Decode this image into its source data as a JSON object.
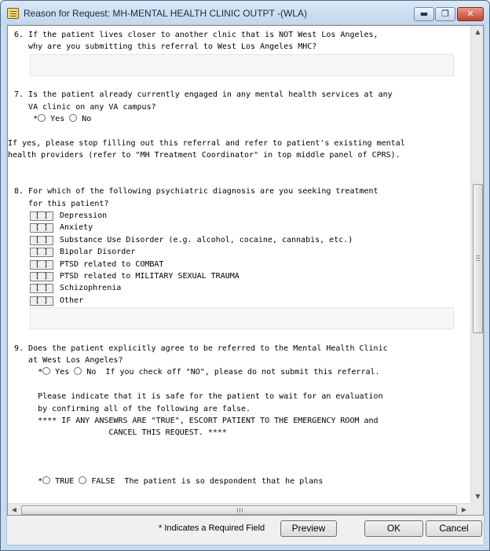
{
  "window": {
    "title": "Reason for Request: MH-MENTAL HEALTH CLINIC OUTPT -(WLA)",
    "minimize_glyph": "▬",
    "maximize_glyph": "❐",
    "close_glyph": "✕"
  },
  "q6": {
    "line1": "6. If the patient lives closer to another clnic that is NOT West Los Angeles,",
    "line2": "   why are you submitting this referral to West Los Angeles MHC?"
  },
  "q7": {
    "line1": "7. Is the patient already currently engaged in any mental health services at any",
    "line2": "   VA clinic on any VA campus?",
    "required_mark": "*",
    "yes_label": "Yes",
    "no_label": "No",
    "note1": "If yes, please stop filling out this referral and refer to patient's existing mental",
    "note2": "health providers (refer to \"MH Treatment Coordinator\" in top middle panel of CPRS)."
  },
  "q8": {
    "line1": "8. For which of the following psychiatric diagnosis are you seeking treatment",
    "line2": "   for this patient?",
    "checkbox_glyph": "[ ]",
    "options": [
      "Depression",
      "Anxiety",
      "Substance Use Disorder (e.g. alcohol, cocaine, cannabis, etc.)",
      "Bipolar Disorder",
      "PTSD related to COMBAT",
      "PTSD related to MILITARY SEXUAL TRAUMA",
      "Schizophrenia",
      "Other"
    ]
  },
  "q9": {
    "line1": "9. Does the patient explicitly agree to be referred to the Mental Health Clinic",
    "line2": "   at West Los Angeles?",
    "required_mark": "*",
    "yes_label": "Yes",
    "no_label": "No",
    "no_note": "If you check off \"NO\", please do not submit this referral.",
    "inst1": "     Please indicate that it is safe for the patient to wait for an evaluation",
    "inst2": "     by confirming all of the following are false.",
    "inst3": "     **** IF ANY ANSEWRS ARE \"TRUE\", ESCORT PATIENT TO THE EMERGENCY ROOM and",
    "inst4": "                    CANCEL THIS REQUEST. ****",
    "true_label": "TRUE",
    "false_label": "FALSE",
    "statement": "The patient is so despondent that he plans"
  },
  "scroll": {
    "up": "▲",
    "down": "▼",
    "left": "◀",
    "right": "▶"
  },
  "footer": {
    "required_note": "* Indicates a Required Field",
    "preview_label": "Preview",
    "ok_label": "OK",
    "cancel_label": "Cancel"
  }
}
